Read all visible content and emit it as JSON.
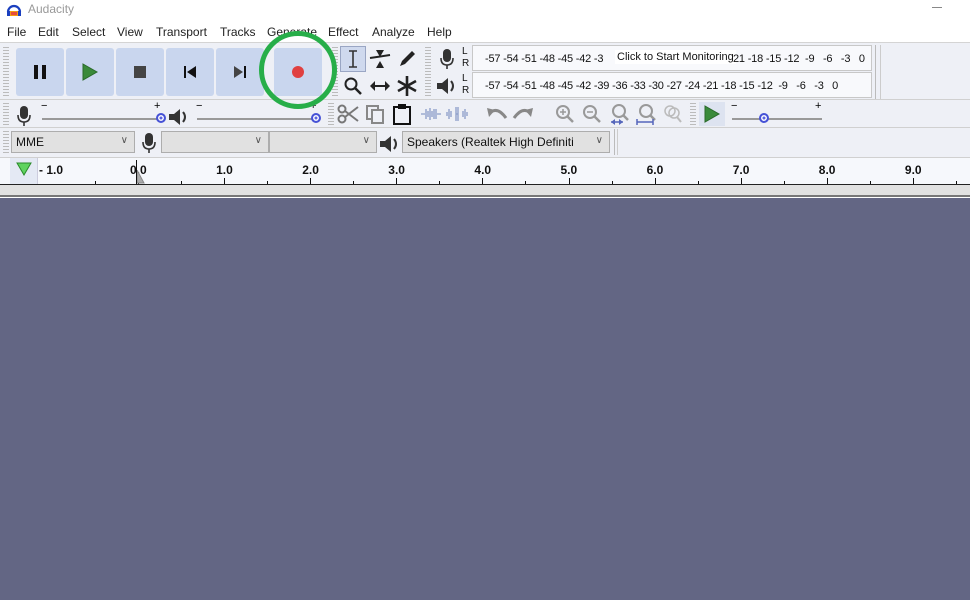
{
  "window": {
    "title": "Audacity",
    "icon": "audacity-headphones-icon"
  },
  "menu": [
    "File",
    "Edit",
    "Select",
    "View",
    "Transport",
    "Tracks",
    "Generate",
    "Effect",
    "Analyze",
    "Help"
  ],
  "transport": {
    "buttons": [
      {
        "name": "pause",
        "icon": "pause-icon"
      },
      {
        "name": "play",
        "icon": "play-icon"
      },
      {
        "name": "stop",
        "icon": "stop-icon"
      },
      {
        "name": "skip-to-start",
        "icon": "skip-start-icon"
      },
      {
        "name": "skip-to-end",
        "icon": "skip-end-icon"
      },
      {
        "name": "record",
        "icon": "record-icon"
      }
    ],
    "highlight": "record"
  },
  "tools": [
    "selection",
    "envelope",
    "draw",
    "zoom",
    "time-shift",
    "multi"
  ],
  "meters": {
    "record_scale": "-57 -54 -51 -48 -45 -42 -3",
    "record_scale_tail": "21 -18 -15 -12  -9   -6   -3   0",
    "record_tip": "Click to Start Monitoring",
    "playback_scale": "-57 -54 -51 -48 -45 -42 -39 -36 -33 -30 -27 -24 -21 -18 -15 -12  -9   -6   -3   0",
    "L": "L",
    "R": "R"
  },
  "mixer": {
    "min": "−",
    "max": "+",
    "record_volume": 1.0,
    "playback_volume": 1.0
  },
  "play_at_speed": {
    "min": "−",
    "max": "+",
    "speed": 0.35
  },
  "device": {
    "host": "MME",
    "recording_device": "",
    "recording_channels": "",
    "playback_device": "Speakers (Realtek High Definiti"
  },
  "ruler": {
    "labels": [
      "- 1.0",
      "0.0",
      "1.0",
      "2.0",
      "3.0",
      "4.0",
      "5.0",
      "6.0",
      "7.0",
      "8.0",
      "9.0"
    ]
  },
  "colors": {
    "accent_record": "#e04040",
    "highlight": "#27ae49",
    "track_bg": "#636684",
    "button_bg": "#c9d6ee",
    "play_green": "#3a8a3a"
  }
}
